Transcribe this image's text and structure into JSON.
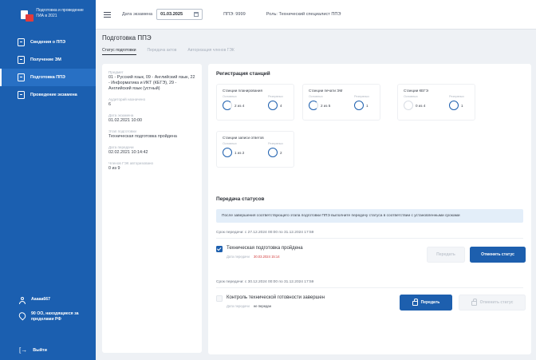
{
  "sidebar": {
    "title": "Подготовка и проведение ГИА в 2021",
    "items": [
      {
        "label": "Сведения о ППЭ"
      },
      {
        "label": "Получение ЭМ"
      },
      {
        "label": "Подготовка ППЭ"
      },
      {
        "label": "Проведение экзамена"
      }
    ],
    "user": "Ааааа667",
    "region": "90 ОО, находящиеся за пределами РФ",
    "logout": "Выйти"
  },
  "topbar": {
    "date_label": "Дата экзамена",
    "date_value": "01.03.2025",
    "ppe": "ППЭ: 9999",
    "role": "Роль: Технический специалист ППЭ"
  },
  "page": {
    "title": "Подготовка ППЭ",
    "tabs": [
      "Статус подготовки",
      "Передача актов",
      "Авторизация членов ГЭК"
    ]
  },
  "left": {
    "fields": [
      {
        "k": "Предмет",
        "v": "01 - Русский язык, 09 - Английский язык, 22 - Информатика и ИКТ (КЕГЭ), 29 - Английский язык (устный)"
      },
      {
        "k": "Аудиторий назначено",
        "v": "6"
      },
      {
        "k": "Дата экзамена",
        "v": "01.02.2021 10:00"
      },
      {
        "k": "Этап подготовки",
        "v": "Техническая подготовка пройдена"
      },
      {
        "k": "Дата передачи",
        "v": "02.02.2021 10:14:42"
      },
      {
        "k": "Членов ГЭК авторизовано",
        "v": "0 из 9"
      }
    ]
  },
  "registration": {
    "title": "Регистрация станций",
    "stations": [
      {
        "name": "Станции планирования",
        "l1": "Основных",
        "l2": "Резервных",
        "v1": "2 из 4",
        "v2": "4"
      },
      {
        "name": "Станции печати ЭМ",
        "l1": "Основных",
        "l2": "Резервных",
        "v1": "2 из 5",
        "v2": "1"
      },
      {
        "name": "Станции КЕГЭ",
        "l1": "Основных",
        "l2": "Резервных",
        "v1": "0 из 4",
        "v2": "1"
      },
      {
        "name": "Станции записи ответов",
        "l1": "Основных",
        "l2": "Резервных",
        "v1": "1 из 2",
        "v2": "2"
      }
    ]
  },
  "transfer": {
    "title": "Передача статусов",
    "info": "После завершения соответствующего этапа подготовки ППЭ выполните передачу статуса в соответствии с установленными сроками",
    "blocks": [
      {
        "period": "Срок передачи: с 27.12.2024 00:00 по 31.12.2024 17:59",
        "status": "Техническая подготовка пройдена",
        "date_label": "Дата передачи",
        "date_value": "30.03.2024 15:14",
        "btn1": "Передать",
        "btn2": "Отменить статус"
      },
      {
        "period": "Срок передачи: с 30.12.2024 00:00 по 31.12.2024 17:59",
        "status": "Контроль технической готовности завершен",
        "date_label": "Дата передачи",
        "date_value": "не передан",
        "btn1": "Передать",
        "btn2": "Отменить статус"
      }
    ]
  }
}
